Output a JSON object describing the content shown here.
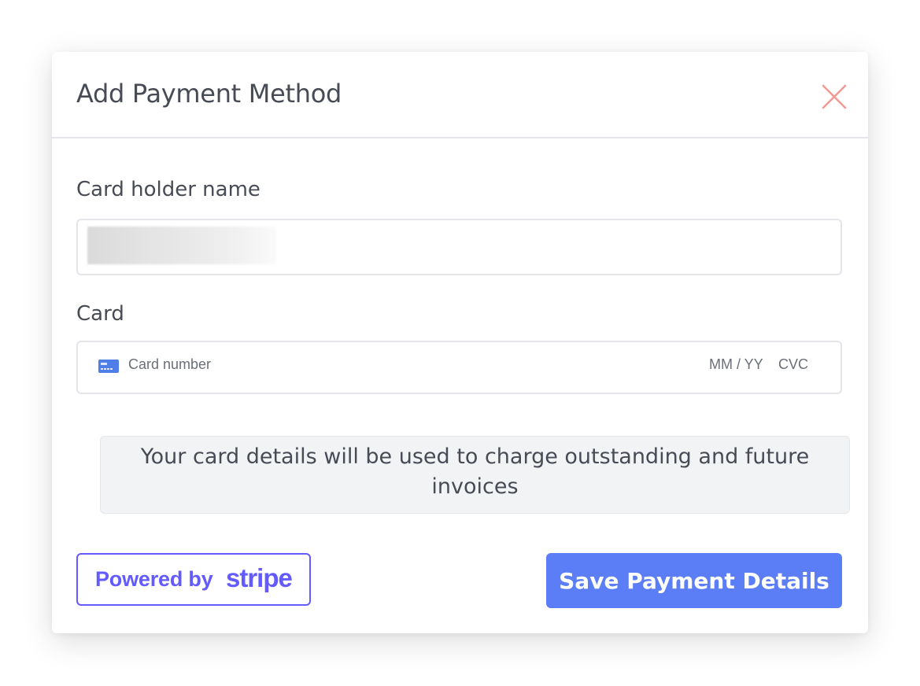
{
  "modal": {
    "title": "Add Payment Method",
    "close_icon": "close-x-icon"
  },
  "card_holder": {
    "label": "Card holder name",
    "value": "[redacted]"
  },
  "card": {
    "label": "Card",
    "icon": "credit-card-icon",
    "number_placeholder": "Card number",
    "expiry_placeholder": "MM / YY",
    "cvc_placeholder": "CVC"
  },
  "notice": {
    "text": "Your card details will be used to charge outstanding and future invoices"
  },
  "footer": {
    "powered_by_label": "Powered by",
    "stripe_logo": "stripe",
    "save_label": "Save Payment Details"
  },
  "colors": {
    "accent": "#5b7df5",
    "stripe": "#635bff",
    "close": "#f19a94",
    "text": "#474b55",
    "notice_bg": "#f2f3f5"
  }
}
